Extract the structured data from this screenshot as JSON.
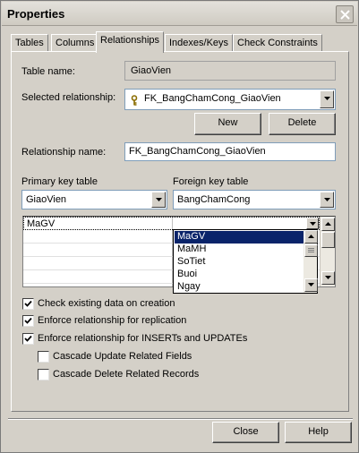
{
  "window": {
    "title": "Properties"
  },
  "tabs": [
    {
      "label": "Tables"
    },
    {
      "label": "Columns"
    },
    {
      "label": "Relationships"
    },
    {
      "label": "Indexes/Keys"
    },
    {
      "label": "Check Constraints"
    }
  ],
  "form": {
    "table_name_label": "Table name:",
    "table_name_value": "GiaoVien",
    "selected_relationship_label": "Selected relationship:",
    "selected_relationship_value": "FK_BangChamCong_GiaoVien",
    "new_button": "New",
    "delete_button": "Delete",
    "relationship_name_label": "Relationship name:",
    "relationship_name_value": "FK_BangChamCong_GiaoVien",
    "primary_key_table_label": "Primary key table",
    "primary_key_table_value": "GiaoVien",
    "foreign_key_table_label": "Foreign key table",
    "foreign_key_table_value": "BangChamCong"
  },
  "grid": {
    "rows": [
      {
        "pk": "MaGV",
        "fk": ""
      }
    ],
    "dropdown_options": [
      "MaGV",
      "MaMH",
      "SoTiet",
      "Buoi",
      "Ngay"
    ],
    "dropdown_selected": "MaGV"
  },
  "checkboxes": [
    {
      "label": "Check existing data on creation",
      "checked": true
    },
    {
      "label": "Enforce relationship for replication",
      "checked": true
    },
    {
      "label": "Enforce relationship for INSERTs and UPDATEs",
      "checked": true
    },
    {
      "label": "Cascade Update Related Fields",
      "checked": false
    },
    {
      "label": "Cascade Delete Related Records",
      "checked": false
    }
  ],
  "footer": {
    "close_button": "Close",
    "help_button": "Help"
  }
}
